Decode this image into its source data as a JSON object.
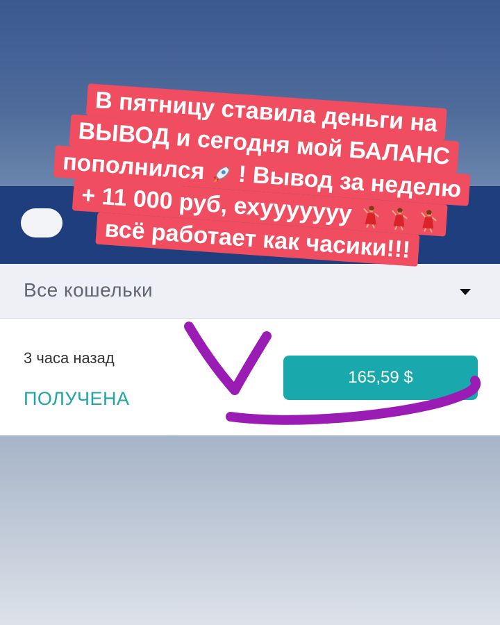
{
  "wallet_selector": {
    "label": "Все кошельки"
  },
  "transaction": {
    "time": "3 часа назад",
    "status": "ПОЛУЧЕНА",
    "amount": "165,59 $"
  },
  "overlay_banner": {
    "line1": "В пятницу ставила деньги на",
    "line2": "ВЫВОД и сегодня мой БАЛАНС",
    "line3_a": "пополнился",
    "line3_b": "! Вывод за неделю",
    "line4": "+ 11 000 руб, ехууууууу",
    "line5": "всё работает как часики!!!"
  },
  "colors": {
    "banner_bg": "#f04e60",
    "header_bg": "#1f3e7d",
    "accent_teal": "#19a9ad",
    "scribble": "#9b1cb5"
  },
  "icons": [
    "rocket-emoji-icon",
    "dancer-emoji-icon",
    "dropdown-arrow-icon"
  ]
}
